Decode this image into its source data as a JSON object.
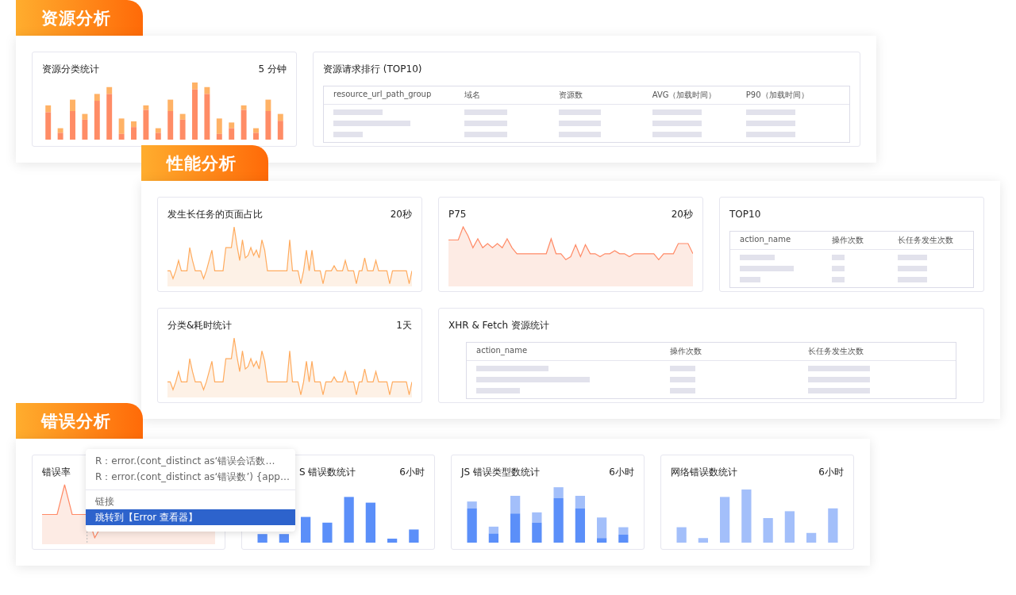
{
  "sections": [
    {
      "title": "资源分析",
      "cards": [
        {
          "kind": "stacked_bar",
          "title": "资源分类统计",
          "period": "5 分钟"
        },
        {
          "kind": "table",
          "title": "资源请求排行 (TOP10)",
          "columns": [
            "resource_url_path_group",
            "域名",
            "资源数",
            "AVG（加载时间）",
            "P90（加载时间）"
          ]
        }
      ]
    },
    {
      "title": "性能分析",
      "cards": [
        {
          "kind": "line",
          "title": "发生长任务的页面占比",
          "period": "20秒"
        },
        {
          "kind": "area",
          "title": "P75",
          "period": "20秒"
        },
        {
          "kind": "table",
          "title": "TOP10",
          "columns": [
            "action_name",
            "操作次数",
            "长任务发生次数"
          ]
        },
        {
          "kind": "line",
          "title": "分类&耗时统计",
          "period": "1天"
        },
        {
          "kind": "table",
          "title": "XHR & Fetch 资源统计",
          "columns": [
            "action_name",
            "操作次数",
            "长任务发生次数"
          ]
        }
      ]
    },
    {
      "title": "错误分析",
      "cards": [
        {
          "kind": "area",
          "title": "错误率"
        },
        {
          "kind": "bar",
          "title": "S 错误数统计",
          "period": "6小时"
        },
        {
          "kind": "stacked_bar",
          "title": "JS 错误类型数统计",
          "period": "6小时"
        },
        {
          "kind": "bar",
          "title": "网络错误数统计",
          "period": "6小时"
        }
      ],
      "menu": [
        {
          "kind": "series",
          "text": "R：error.(cont_distinct as‘错误会话数…",
          "selected": false
        },
        {
          "kind": "series",
          "text": "R：error.(cont_distinct as‘错误数’) {app…",
          "selected": false
        },
        {
          "kind": "header",
          "text": "链接",
          "selected": false
        },
        {
          "kind": "action",
          "text": "跳转到【Error 查看器】",
          "selected": true
        }
      ]
    }
  ]
}
